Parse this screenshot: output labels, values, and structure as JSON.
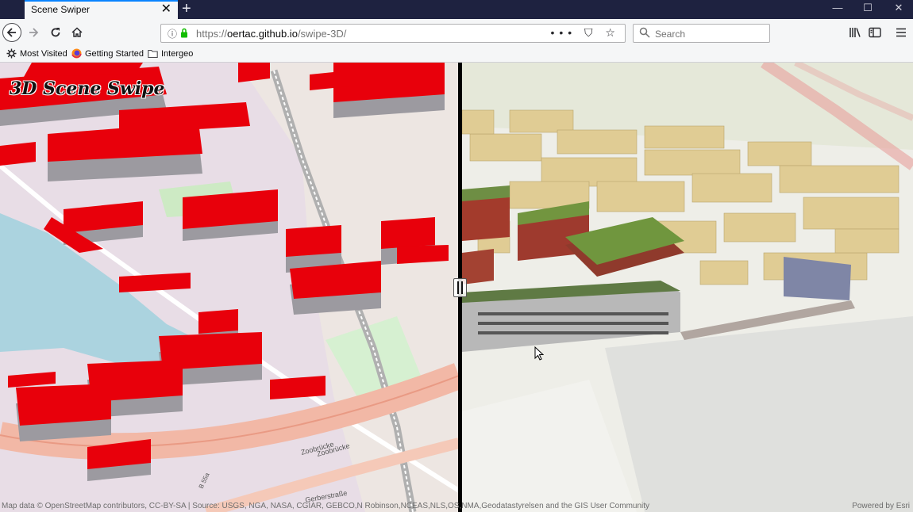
{
  "browser": {
    "tab_title": "Scene Swiper",
    "tab_close": "✕",
    "new_tab": "+",
    "window_controls": {
      "minimize": "—",
      "maximize": "☐",
      "close": "✕"
    }
  },
  "nav": {
    "url_prefix": "https://",
    "url_main": "oertac.github.io",
    "url_path": "/swipe-3D/",
    "search_placeholder": "Search",
    "page_actions": "••• ⛉ ☆",
    "library_icon": "|||\\",
    "sidebar_icon": "▥",
    "menu_icon": "≡"
  },
  "bookmarks": [
    {
      "label": "Most Visited",
      "icon": "gear-icon"
    },
    {
      "label": "Getting Started",
      "icon": "firefox-icon"
    },
    {
      "label": "Intergeo",
      "icon": "folder-icon"
    }
  ],
  "scene": {
    "title": "3D Scene Swipe",
    "attribution_left": "Map data © OpenStreetMap contributors, CC-BY-SA | Source: USGS, NGA, NASA, CGIAR, GEBCO,N Robinson,NCEAS,NLS,OS,NMA,Geodatastyrelsen and the GIS User Community",
    "attribution_right": "Powered by Esri",
    "street_labels": [
      "Zoobrücke",
      "Zoobrücke",
      "Gerberstraße",
      "B 55a"
    ],
    "colors": {
      "buildings_left": "#e8000b",
      "buildings_right": "#e0cc94",
      "divider": "#000000"
    }
  }
}
